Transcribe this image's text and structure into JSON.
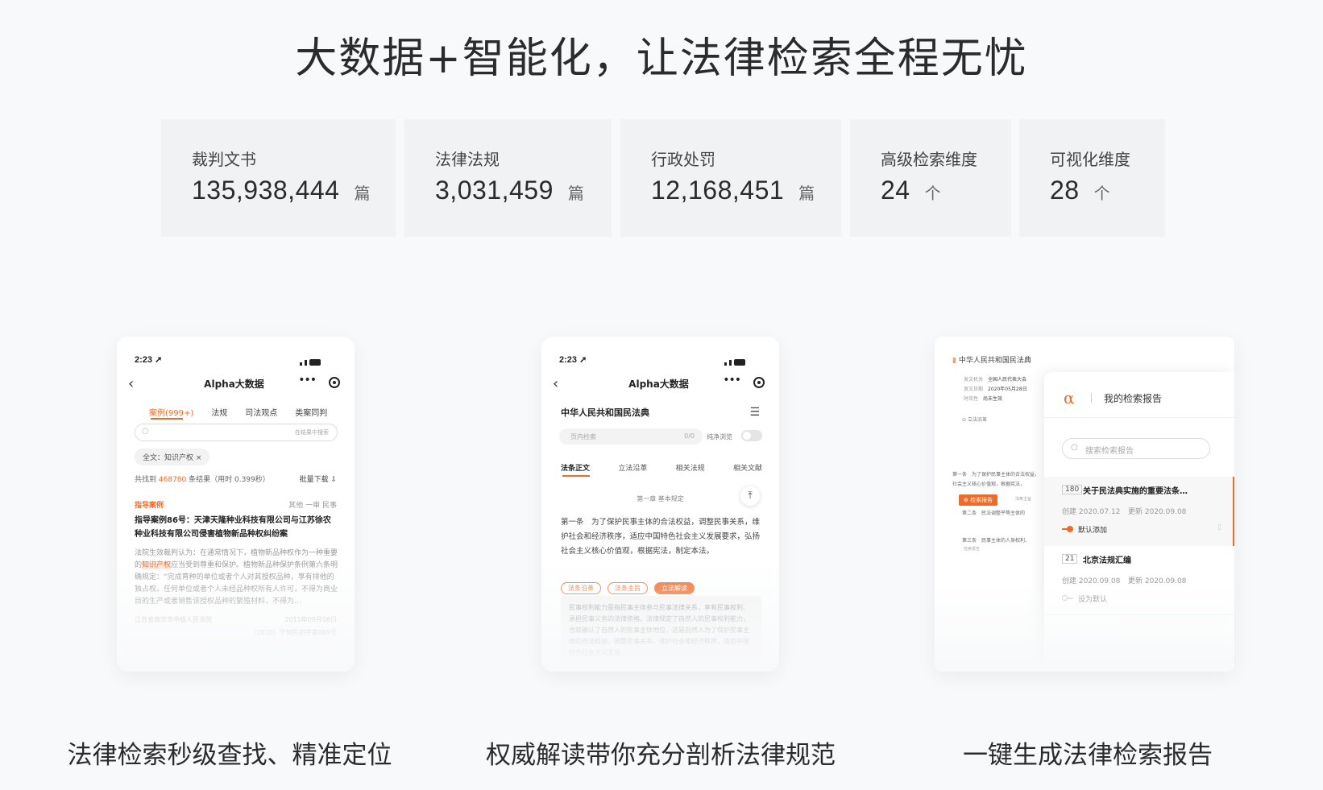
{
  "headline": "大数据+智能化，让法律检索全程无忧",
  "stats": [
    {
      "label": "裁判文书",
      "value": "135,938,444",
      "unit": "篇"
    },
    {
      "label": "法律法规",
      "value": "3,031,459",
      "unit": "篇"
    },
    {
      "label": "行政处罚",
      "value": "12,168,451",
      "unit": "篇"
    },
    {
      "label": "高级检索维度",
      "value": "24",
      "unit": "个"
    },
    {
      "label": "可视化维度",
      "value": "28",
      "unit": "个"
    }
  ],
  "phone1": {
    "time": "2:23",
    "title": "Alpha大数据",
    "tabs": [
      "案例(999+)",
      "法规",
      "司法观点",
      "类案同判"
    ],
    "search_hint": "在结果中搜索",
    "chip": "全文：知识产权 ×",
    "result_prefix": "共找到",
    "result_count": "468780",
    "result_suffix": "条结果（用时 0.399秒）",
    "batch_download": "批量下载",
    "case_tag": "指导案例",
    "case_meta": "其他 一审 民事",
    "case_title": "指导案例86号：天津天隆种业科技有限公司与江苏徐农种业科技有限公司侵害植物新品种权纠纷案",
    "case_body_a": "法院生效裁判认为：在通常情况下，植物新品种权作为一种重要的",
    "case_body_hl": "知识产权",
    "case_body_b": "应当受到尊重和保护。植物新品种保护条例第六条明确规定：“完成育种的单位或者个人对其授权品种，享有排他的独占权。任何单位或者个人未经品种权所有人许可，不得为商业目的生产或者销售该授权品种的繁殖材料，不得为…",
    "court": "江苏省南京市中级人民法院",
    "date": "2011年09月08日",
    "case_no": "（2010）宁知民初字第069号"
  },
  "phone2": {
    "time": "2:23",
    "title": "Alpha大数据",
    "law_title": "中华人民共和国民法典",
    "inpage_search": "页内检索",
    "search_count": "0/0",
    "pure_view": "纯净浏览",
    "tabs": [
      "法条正文",
      "立法沿革",
      "相关法规",
      "相关文献"
    ],
    "chapter": "第一章 基本规定",
    "article": "第一条　为了保护民事主体的合法权益，调整民事关系，维护社会和经济秩序，适应中国特色社会主义发展要求，弘扬社会主义核心价值观，根据宪法，制定本法。",
    "buttons": [
      "法条沿革",
      "法条主旨",
      "立法解读"
    ],
    "interp": "民事权利能力是指民事主体参与民事法律关系，享有民事权利、承担民事义务的法律资格。法律规定了自然人的民事权利能力，也就确认了自然人的民事主体地位，这是自然人为了保护民事主体的合法权益，调整民事关系，维护社会和经济秩序，适应中国特色社会主义发展"
  },
  "panel3": {
    "doc_title": "中华人民共和国民法典",
    "meta": [
      [
        "发文机关",
        "全国人民代表大会"
      ],
      [
        "发文日期",
        "2020年05月28日"
      ],
      [
        "时效性",
        "尚未生效"
      ]
    ],
    "outline": "立法沿革",
    "art1": "第一条　为了保护民事主体的合法权益，社会主义核心价值观，根据宪法，",
    "report_btn": "检索报告",
    "art2": "第二条　民法调整平等主体的",
    "art3": "第三条　民事主体的人身权利、",
    "side_tag": "法条主旨",
    "side_tag2": "检索报告",
    "my_reports": "我的检索报告",
    "search_placeholder": "搜索检索报告",
    "reports": [
      {
        "count": "180",
        "name": "关于民法典实施的重要法条…",
        "created": "创建 2020.07.12",
        "updated": "更新 2020.09.08",
        "toggle": "默认添加"
      },
      {
        "count": "21",
        "name": "北京法规汇编",
        "created": "创建 2020.09.08",
        "updated": "更新 2020.09.08",
        "toggle": "设为默认"
      }
    ]
  },
  "captions": [
    "法律检索秒级查找、精准定位",
    "权威解读带你充分剖析法律规范",
    "一键生成法律检索报告"
  ],
  "colors": {
    "accent": "#f06a28",
    "bg": "#f8f9fa",
    "stat_bg": "#f1f2f4"
  }
}
